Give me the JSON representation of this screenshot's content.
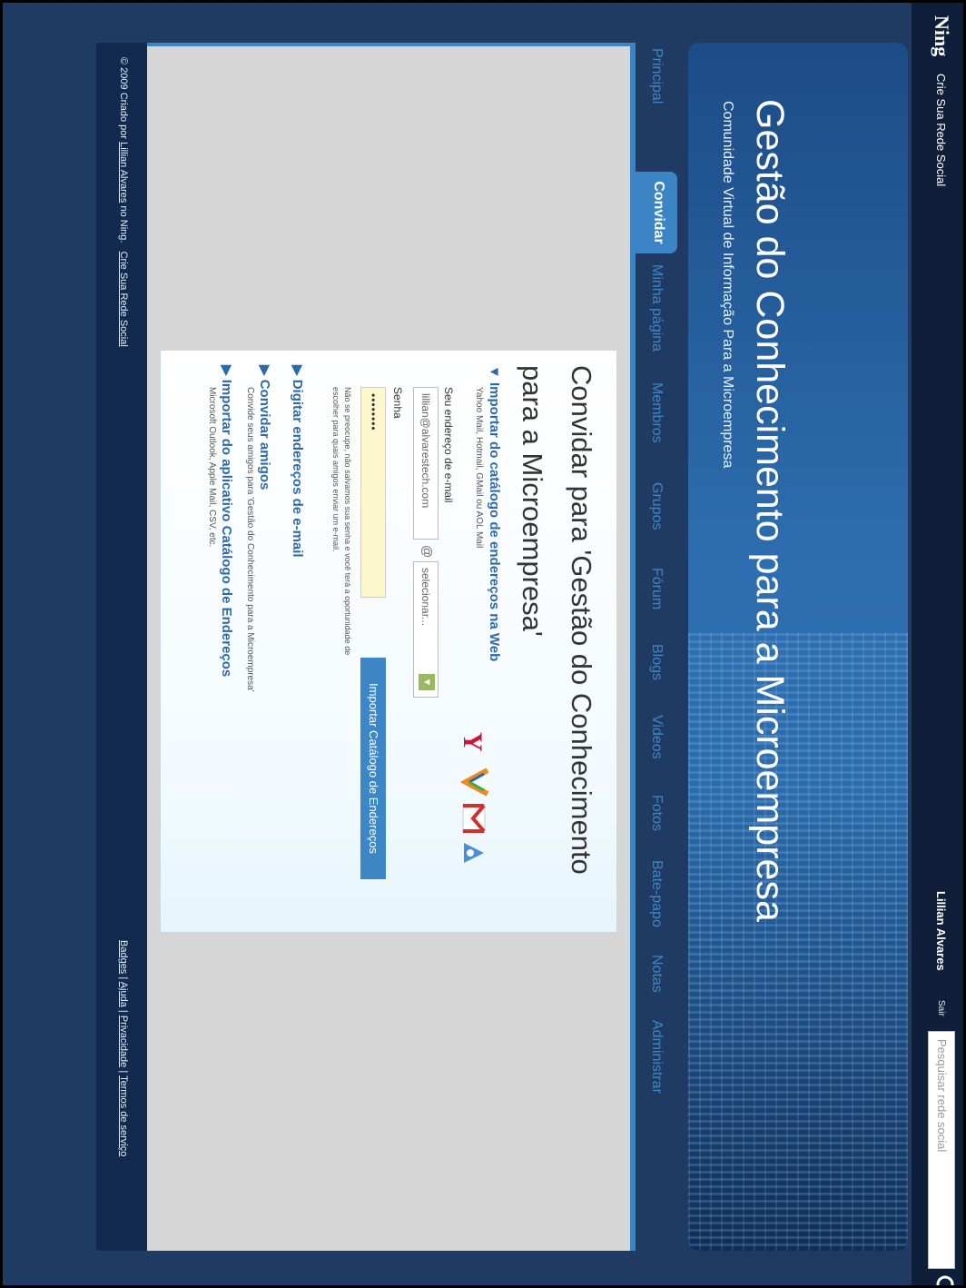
{
  "topbar": {
    "logo": "Ning",
    "create_link": "Crie Sua Rede Social",
    "user_name": "Lillian Alvares",
    "sair": "Sair",
    "search_placeholder": "Pesquisar rede social"
  },
  "header": {
    "title": "Gestão do Conhecimento para a Microempresa",
    "subtitle": "Comunidade Virtual de Informação Para a Microempresa"
  },
  "nav": {
    "items": [
      "Principal",
      "Convidar",
      "Minha página",
      "Membros",
      "Grupos",
      "Fórum",
      "Blogs",
      "Videos",
      "Fotos",
      "Bate-papo",
      "Notas",
      "Administrar"
    ],
    "active": "Convidar"
  },
  "invite": {
    "heading": "Convidar para 'Gestão do Conhecimento para a Microempresa'",
    "import_title": "Importar do catálogo de endereços na Web",
    "import_subtitle": "Yahoo Mail, Hotmail, GMail ou AOL Mail",
    "email_label": "Seu endereço de e-mail",
    "email_value": "lillian@alvarestech.com",
    "at_sign": "@",
    "domain_select": "selecionar...",
    "password_label": "Senha",
    "password_value": "••••••••",
    "import_button": "Importar Catálogo de Endereços",
    "note": "Não se preocupe, não salvamos sua senha e você terá a oportunidade de escolher para quais amigos enviar um e-mail.",
    "options": [
      {
        "title": "Digitar endereços de e-mail",
        "subtitle": ""
      },
      {
        "title": "Convidar amigos",
        "subtitle": "Convide seus amigos para 'Gestão do Conhecimento para a Microempresa'"
      },
      {
        "title": "Importar do aplicativo Catálogo de Endereços",
        "subtitle": "Microsoft Outlook, Apple Mail, CSV, etc."
      }
    ]
  },
  "footer": {
    "copyright": "© 2009",
    "created_by": "Criado por",
    "creator": "Lillian Alvares",
    "on_ning": "no Ning.",
    "create_link": "Crie Sua Rede Social",
    "badges": "Badges",
    "help": "Ajuda",
    "privacy": "Privacidade",
    "terms": "Termos de serviço",
    "separator": "|"
  },
  "colors": {
    "background": "#1f3b63",
    "accent": "#3b85c4",
    "content_gray": "#d6d6d6"
  }
}
